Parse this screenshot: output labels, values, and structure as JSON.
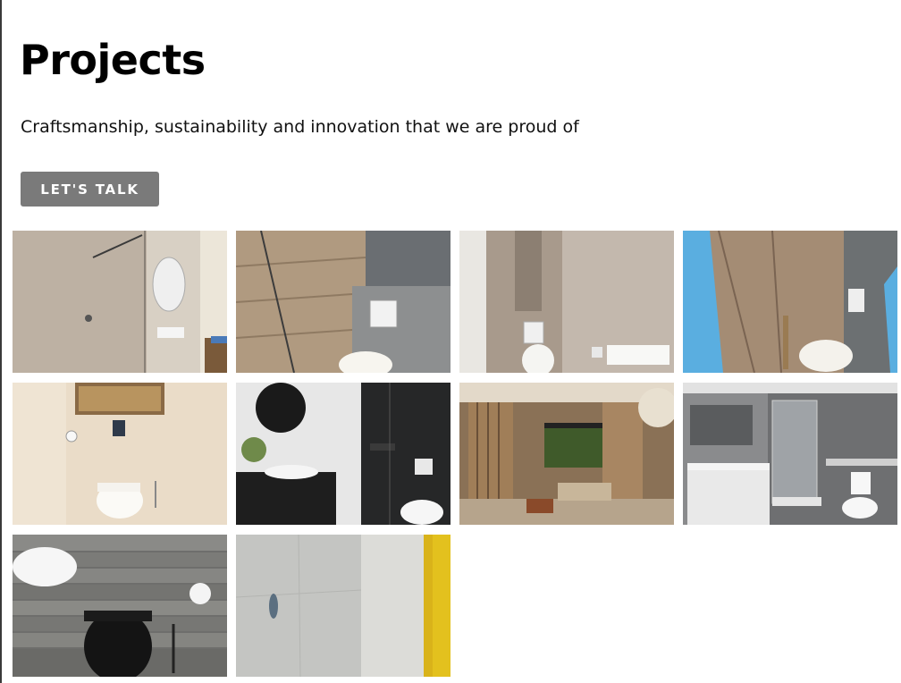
{
  "header": {
    "title": "Projects",
    "subtitle": "Craftsmanship, sustainability and innovation that we are proud of"
  },
  "cta": {
    "label": "LET'S TALK",
    "color": "#7a7a7a"
  },
  "gallery": {
    "items": [
      {
        "name": "project-photo-shower-glass"
      },
      {
        "name": "project-photo-wood-tile-wc"
      },
      {
        "name": "project-photo-stone-niche-wc"
      },
      {
        "name": "project-photo-blue-door-wc"
      },
      {
        "name": "project-photo-beige-wc-shelf"
      },
      {
        "name": "project-photo-black-bathroom"
      },
      {
        "name": "project-photo-living-room"
      },
      {
        "name": "project-photo-grey-bathroom"
      },
      {
        "name": "project-photo-slate-wc"
      },
      {
        "name": "project-photo-marble-wall"
      }
    ]
  }
}
